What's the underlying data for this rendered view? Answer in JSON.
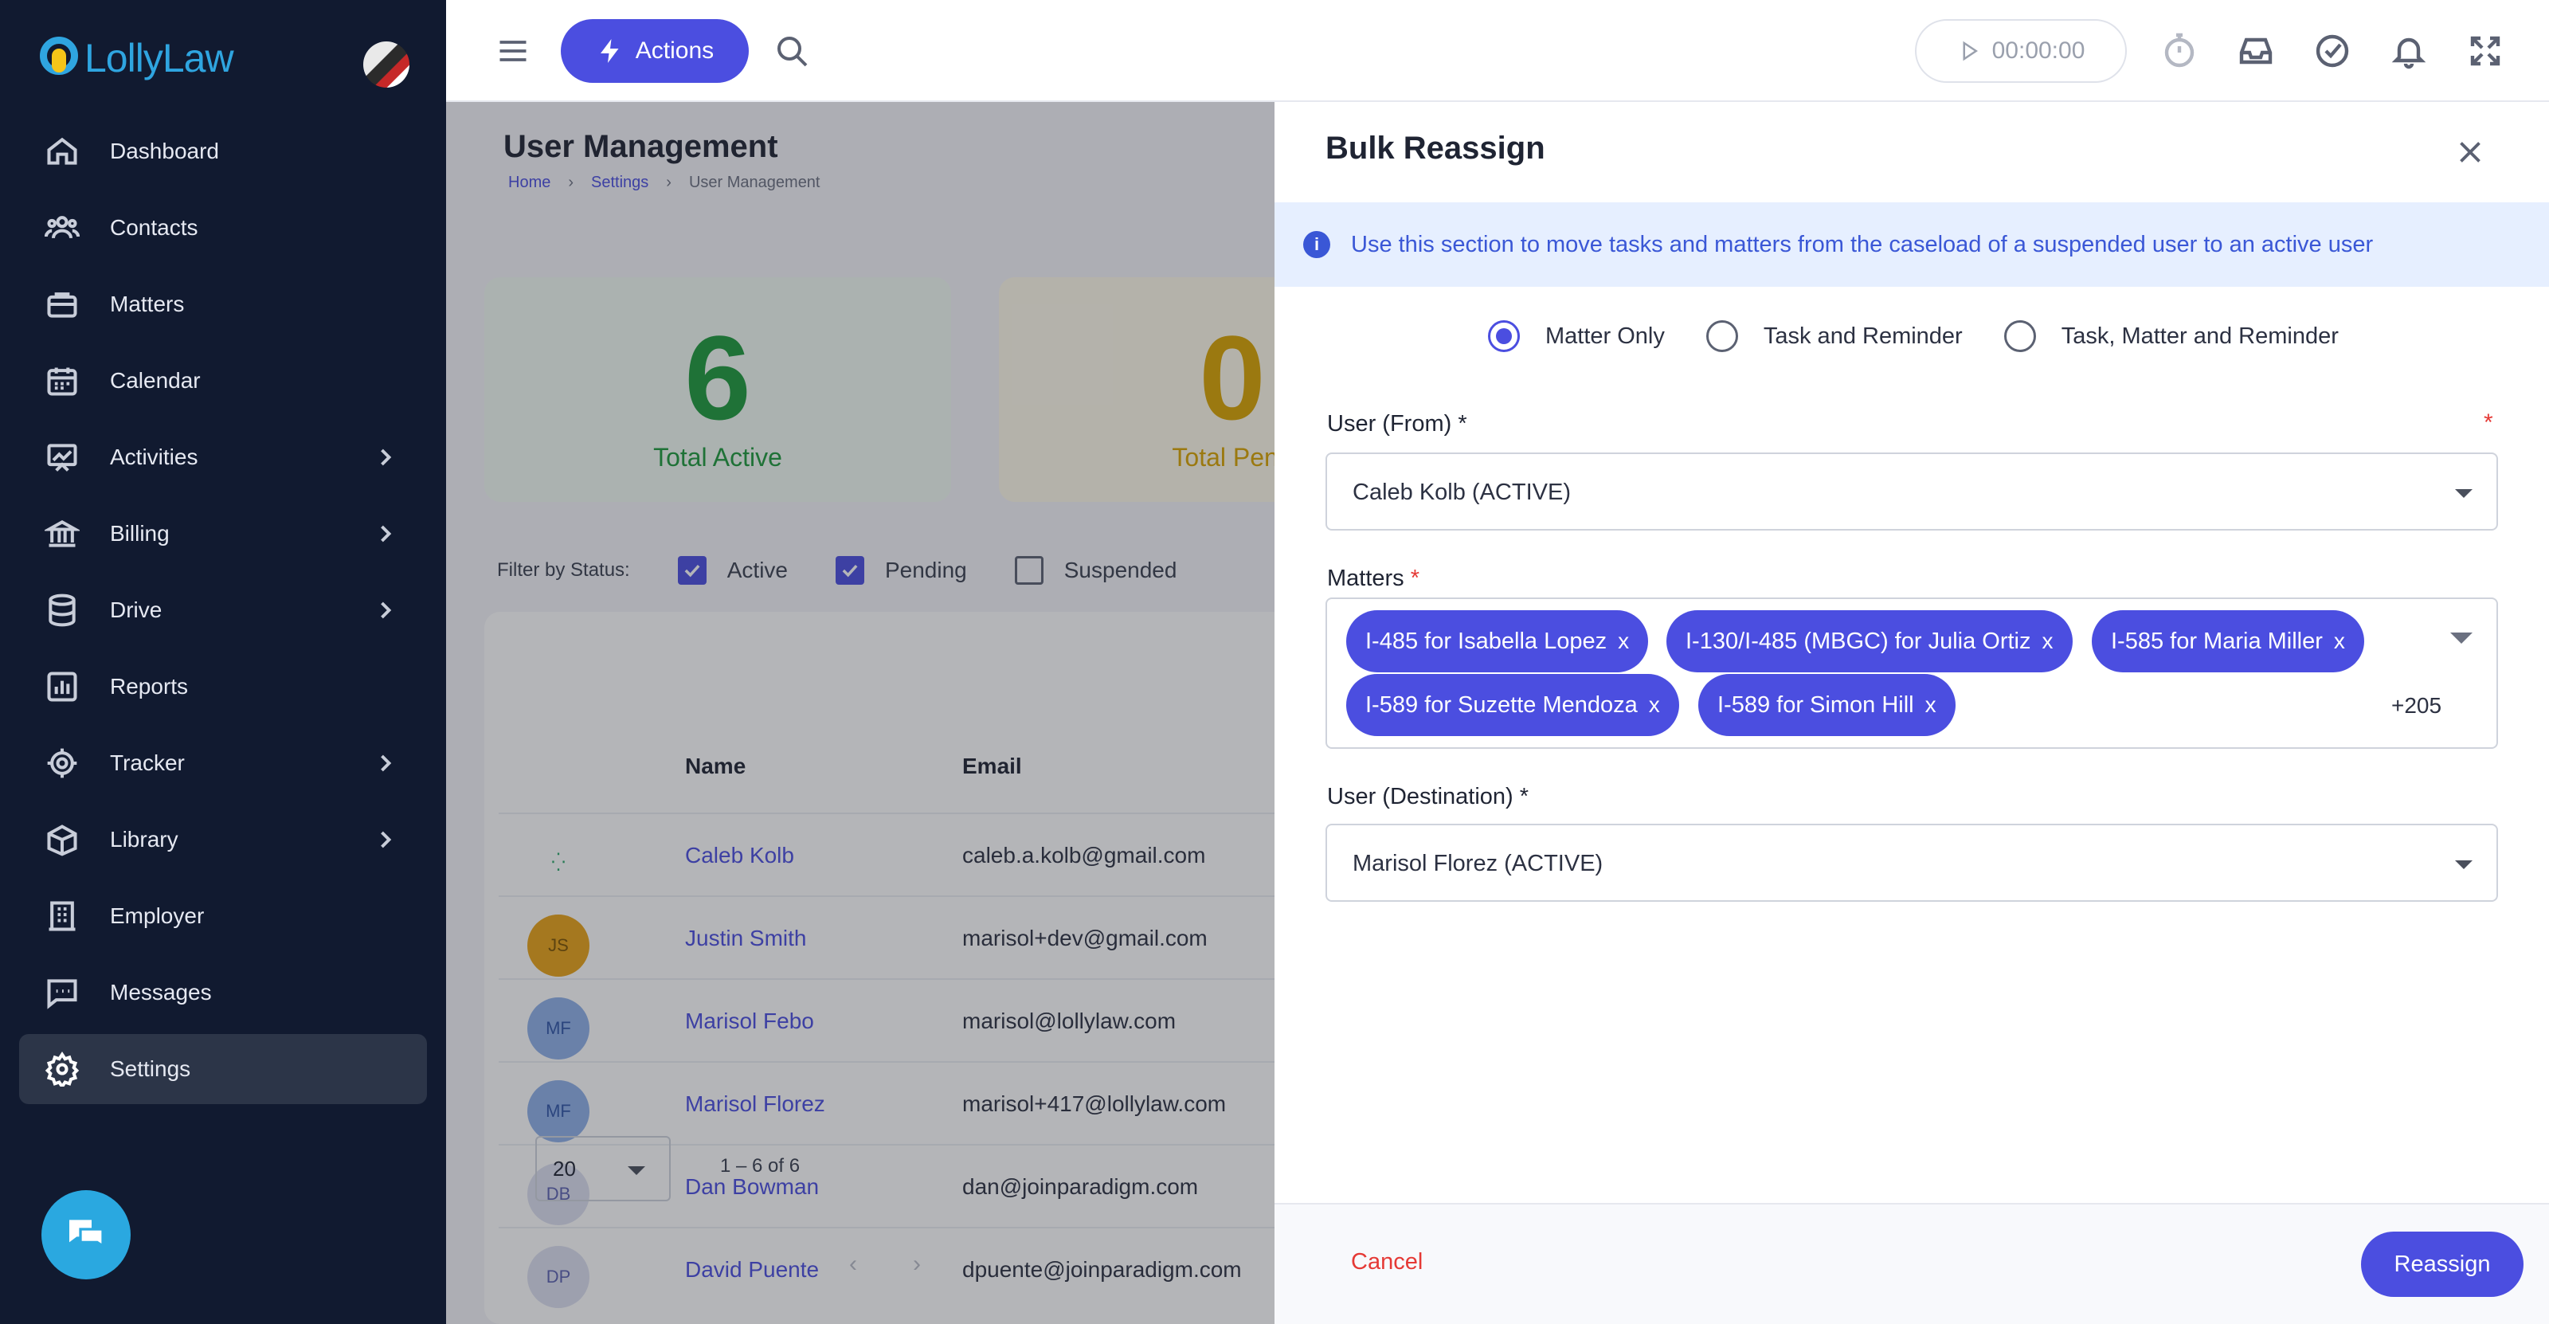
{
  "app": {
    "logo_text": "LollyLaw"
  },
  "sidebar": {
    "items": [
      {
        "label": "Dashboard",
        "icon": "home-icon",
        "chevron": false
      },
      {
        "label": "Contacts",
        "icon": "users-icon",
        "chevron": false
      },
      {
        "label": "Matters",
        "icon": "briefcase-icon",
        "chevron": false
      },
      {
        "label": "Calendar",
        "icon": "calendar-icon",
        "chevron": false
      },
      {
        "label": "Activities",
        "icon": "activity-chart-icon",
        "chevron": true
      },
      {
        "label": "Billing",
        "icon": "bank-icon",
        "chevron": true
      },
      {
        "label": "Drive",
        "icon": "database-icon",
        "chevron": true
      },
      {
        "label": "Reports",
        "icon": "bar-chart-icon",
        "chevron": false
      },
      {
        "label": "Tracker",
        "icon": "target-icon",
        "chevron": true
      },
      {
        "label": "Library",
        "icon": "book-box-icon",
        "chevron": true
      },
      {
        "label": "Employer",
        "icon": "building-icon",
        "chevron": false
      },
      {
        "label": "Messages",
        "icon": "message-icon",
        "chevron": false
      },
      {
        "label": "Settings",
        "icon": "gear-icon",
        "chevron": false,
        "active": true
      }
    ]
  },
  "topbar": {
    "actions_label": "Actions",
    "timer": "00:00:00"
  },
  "page": {
    "title": "User Management",
    "breadcrumbs": [
      "Home",
      "Settings",
      "User Management"
    ]
  },
  "stats": [
    {
      "value": "6",
      "label": "Total Active",
      "color": "#1e9a3c"
    },
    {
      "value": "0",
      "label": "Total Pend",
      "color": "#d9a400"
    }
  ],
  "filter": {
    "label": "Filter by Status:",
    "options": [
      {
        "label": "Active",
        "checked": true
      },
      {
        "label": "Pending",
        "checked": true
      },
      {
        "label": "Suspended",
        "checked": false
      }
    ]
  },
  "table": {
    "headers": [
      "Name",
      "Email"
    ],
    "rows": [
      {
        "initials": "",
        "name": "Caleb Kolb",
        "email": "caleb.a.kolb@gmail.com"
      },
      {
        "initials": "JS",
        "name": "Justin Smith",
        "email": "marisol+dev@gmail.com"
      },
      {
        "initials": "MF",
        "name": "Marisol Febo",
        "email": "marisol@lollylaw.com"
      },
      {
        "initials": "MF",
        "name": "Marisol Florez",
        "email": "marisol+417@lollylaw.com"
      },
      {
        "initials": "DB",
        "name": "Dan Bowman",
        "email": "dan@joinparadigm.com"
      },
      {
        "initials": "DP",
        "name": "David Puente",
        "email": "dpuente@joinparadigm.com"
      }
    ],
    "page_size": "20",
    "range": "1 – 6 of 6"
  },
  "drawer": {
    "title": "Bulk Reassign",
    "info": "Use this section to move tasks and matters from the caseload of a suspended user to an active user",
    "modes": [
      {
        "label": "Matter Only",
        "selected": true
      },
      {
        "label": "Task and Reminder",
        "selected": false
      },
      {
        "label": "Task, Matter and Reminder",
        "selected": false
      }
    ],
    "from_label": "User (From)",
    "from_value": "Caleb Kolb (ACTIVE)",
    "matters_label": "Matters",
    "matters": [
      "I-485 for Isabella Lopez",
      "I-130/I-485 (MBGC) for Julia Ortiz",
      "I-585 for Maria Miller",
      "I-589 for Suzette Mendoza",
      "I-589 for Simon Hill"
    ],
    "chip_remove": "x",
    "matters_more": "+205",
    "dest_label": "User (Destination)",
    "dest_value": "Marisol Florez (ACTIVE)",
    "required_mark": "*",
    "cancel_label": "Cancel",
    "submit_label": "Reassign"
  },
  "colors": {
    "primary": "#4b4ee0",
    "sidebar": "#111a30",
    "danger": "#e53935"
  }
}
